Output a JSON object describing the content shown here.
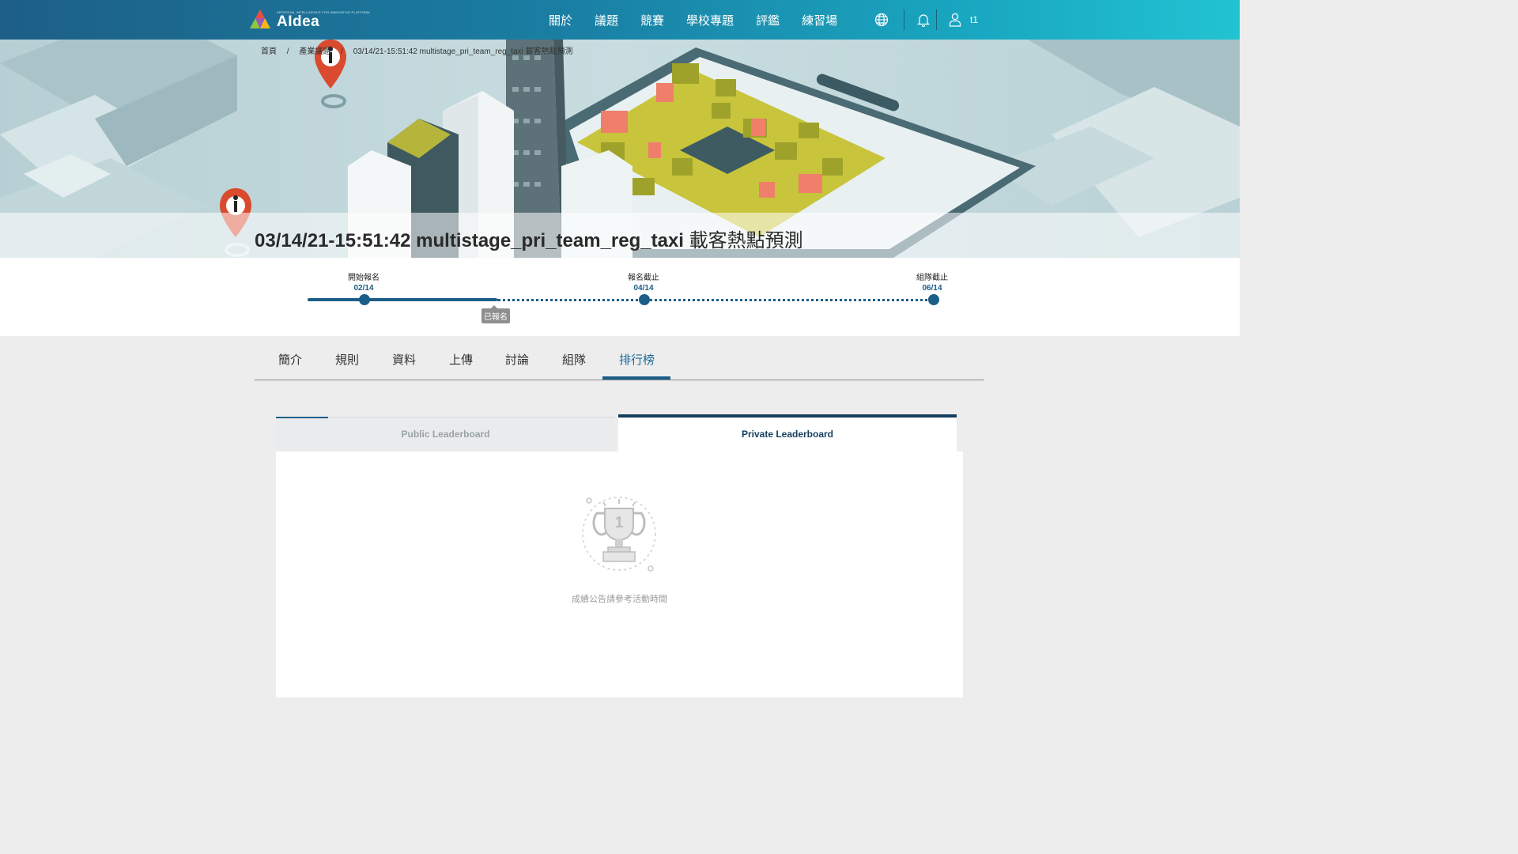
{
  "brand": {
    "tagline": "ARTIFICIAL INTELLIGENCE FOR INNOVATIVE PLATFORM",
    "name": "AIdea"
  },
  "nav": {
    "items": [
      "關於",
      "議題",
      "競賽",
      "學校專題",
      "評鑑",
      "練習場"
    ],
    "icons": [
      "globe-icon",
      "bell-icon",
      "user-icon"
    ],
    "username": "t1"
  },
  "breadcrumb": [
    "首頁",
    "/",
    "產業議題",
    "/",
    "03/14/21-15:51:42 multistage_pri_team_reg_taxi 載客熱點預測"
  ],
  "page": {
    "title_en": "03/14/21-15:51:42 multistage_pri_team_reg_taxi ",
    "title_zh": "載客熱點預測"
  },
  "timeline": {
    "milestones": [
      {
        "name": "開始報名",
        "date": "02/14"
      },
      {
        "name": "報名截止",
        "date": "04/14"
      },
      {
        "name": "組隊截止",
        "date": "06/14"
      }
    ],
    "status_badge": "已報名"
  },
  "tabs": [
    "簡介",
    "規則",
    "資料",
    "上傳",
    "討論",
    "組隊",
    "排行榜"
  ],
  "active_tab": "排行榜",
  "leaderboard": {
    "public_label": "Public Leaderboard",
    "private_label": "Private Leaderboard",
    "empty_message": "成績公告請參考活動時間",
    "trophy_icon": "trophy-icon"
  },
  "colors": {
    "primary": "#1b5e88",
    "dark": "#143e5e",
    "accent": "#22c3d3"
  }
}
